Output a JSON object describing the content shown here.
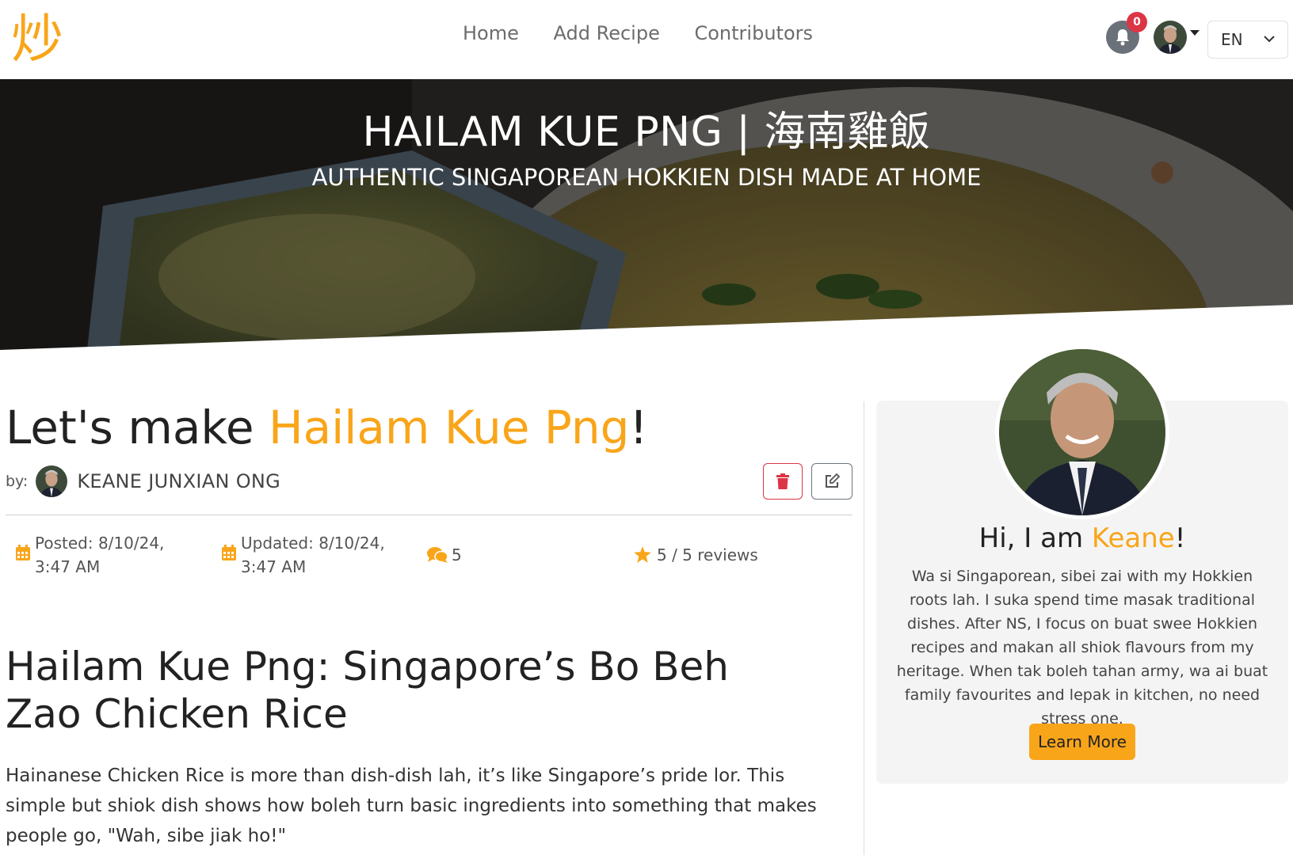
{
  "nav": {
    "logo_char": "炒",
    "links": [
      "Home",
      "Add Recipe",
      "Contributors"
    ],
    "notification_count": "0",
    "language": "EN"
  },
  "hero": {
    "title": "HAILAM KUE PNG | 海南雞飯",
    "subtitle": "AUTHENTIC SINGAPOREAN HOKKIEN DISH MADE AT HOME"
  },
  "recipe": {
    "title_prefix": "Let's make ",
    "title_accent": "Hailam Kue Png",
    "title_suffix": "!",
    "by_label": "by:",
    "author": "KEANE JUNXIAN ONG",
    "posted": "Posted: 8/10/24, 3:47 AM",
    "updated": "Updated: 8/10/24, 3:47 AM",
    "comments": "5",
    "rating": "5 / 5 reviews",
    "section_title": "Hailam Kue Png: Singapore’s Bo Beh Zao Chicken Rice",
    "intro": "Hainanese Chicken Rice is more than dish-dish lah, it’s like Singapore’s pride lor. This simple but shiok dish shows how boleh turn basic ingredients into something that makes people go, \"Wah, sibe jiak ho!\""
  },
  "author_card": {
    "hi_prefix": "Hi, I am ",
    "name": "Keane",
    "hi_suffix": "!",
    "bio": "Wa si Singaporean, sibei zai with my Hokkien roots lah. I suka spend time masak traditional dishes. After NS, I focus on buat swee Hokkien recipes and makan all shiok flavours from my heritage. When tak boleh tahan army, wa ai buat family favourites and lepak in kitchen, no need stress one.",
    "button": "Learn More"
  },
  "colors": {
    "accent": "#f9a51a",
    "danger": "#dc3545",
    "badge": "#dc3545"
  },
  "icons": [
    "bell-icon",
    "calendar-icon",
    "comments-icon",
    "star-icon",
    "trash-icon",
    "edit-icon",
    "chevron-down-icon"
  ]
}
